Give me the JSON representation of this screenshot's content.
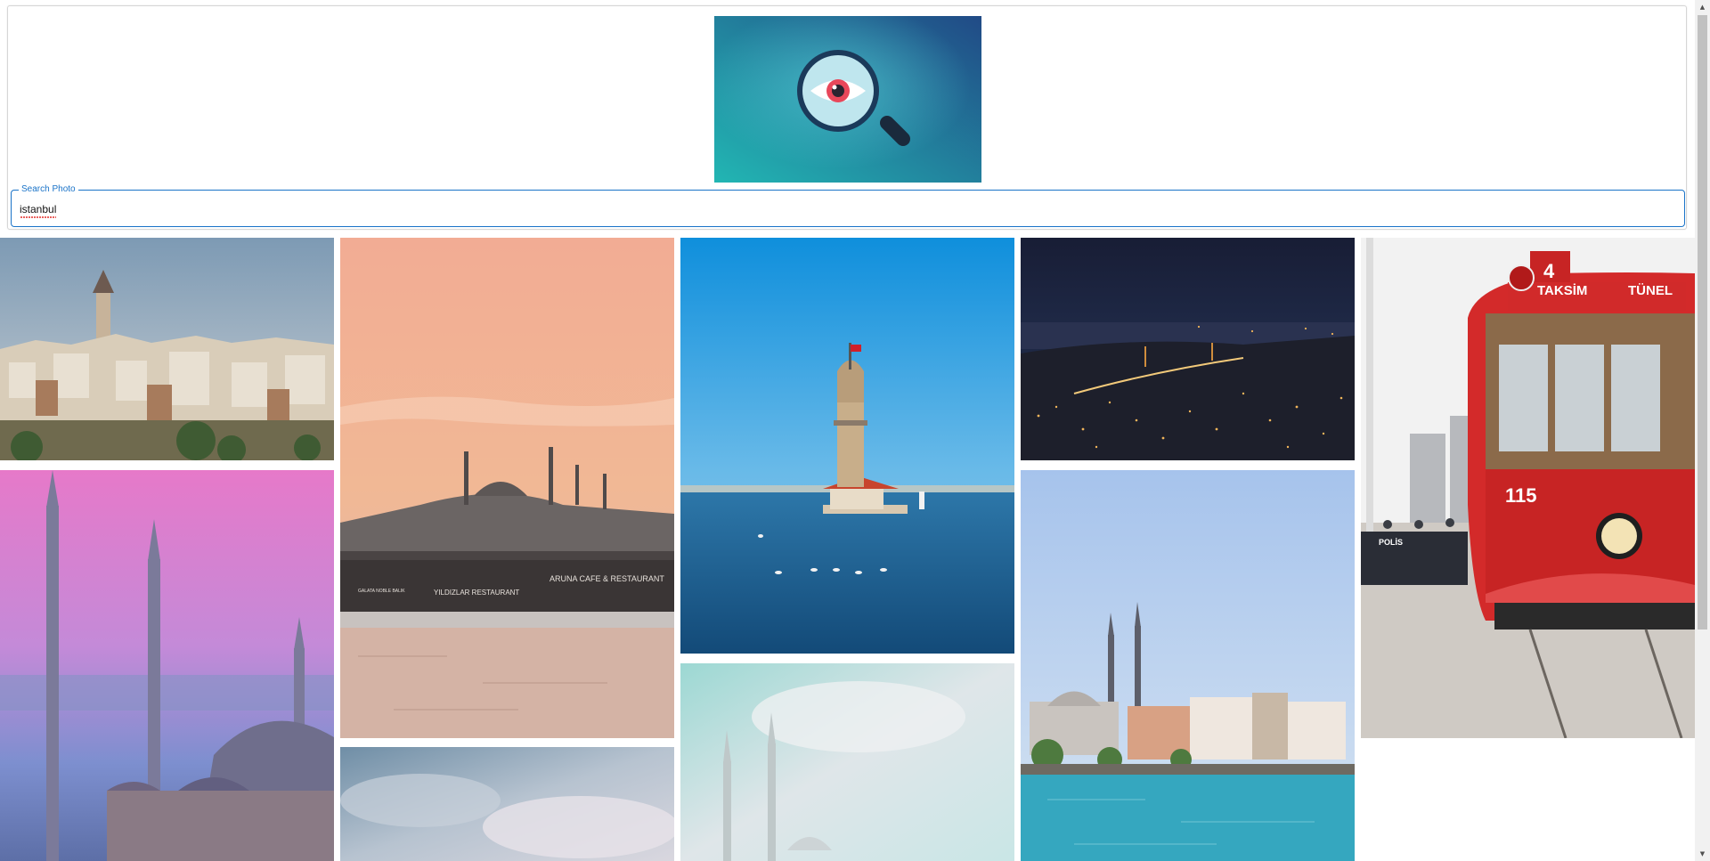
{
  "search": {
    "legend": "Search Photo",
    "value": "istanbul"
  },
  "logo": {
    "icon": "magnifier-eye-icon",
    "colors": {
      "bg_start": "#22b3b5",
      "bg_end": "#1e4d85",
      "iris": "#e8475a"
    }
  },
  "gallery": {
    "photos": [
      {
        "name": "galata-tower-skyline",
        "subject": "Galata Tower skyline"
      },
      {
        "name": "sultan-ahmed-mosque-sunset",
        "subject": "Blue Mosque at pink sunset"
      },
      {
        "name": "suleymaniye-galata-bridge",
        "subject": "Suleymaniye Mosque and Galata Bridge",
        "signs": [
          "ARUNA CAFE & RESTAURANT",
          "YILDIZLAR RESTAURANT",
          "GALATA NOBLE BALIK"
        ]
      },
      {
        "name": "cloudy-sky",
        "subject": "Cloudy sky"
      },
      {
        "name": "maidens-tower",
        "subject": "Maiden's Tower on the Bosphorus"
      },
      {
        "name": "mosque-cloudy-sky",
        "subject": "Mosque minarets under clouds"
      },
      {
        "name": "bosphorus-bridge-night",
        "subject": "Bosphorus Bridge at night"
      },
      {
        "name": "ortakoy-mosque",
        "subject": "Ortakoy Mosque waterfront"
      },
      {
        "name": "taksim-tunel-tram",
        "subject": "Red nostalgic tram",
        "signs": [
          "TAKSİM",
          "TÜNEL",
          "4",
          "115",
          "POLİS"
        ]
      }
    ]
  },
  "scrollbar": {
    "up": "▲",
    "down": "▼"
  }
}
